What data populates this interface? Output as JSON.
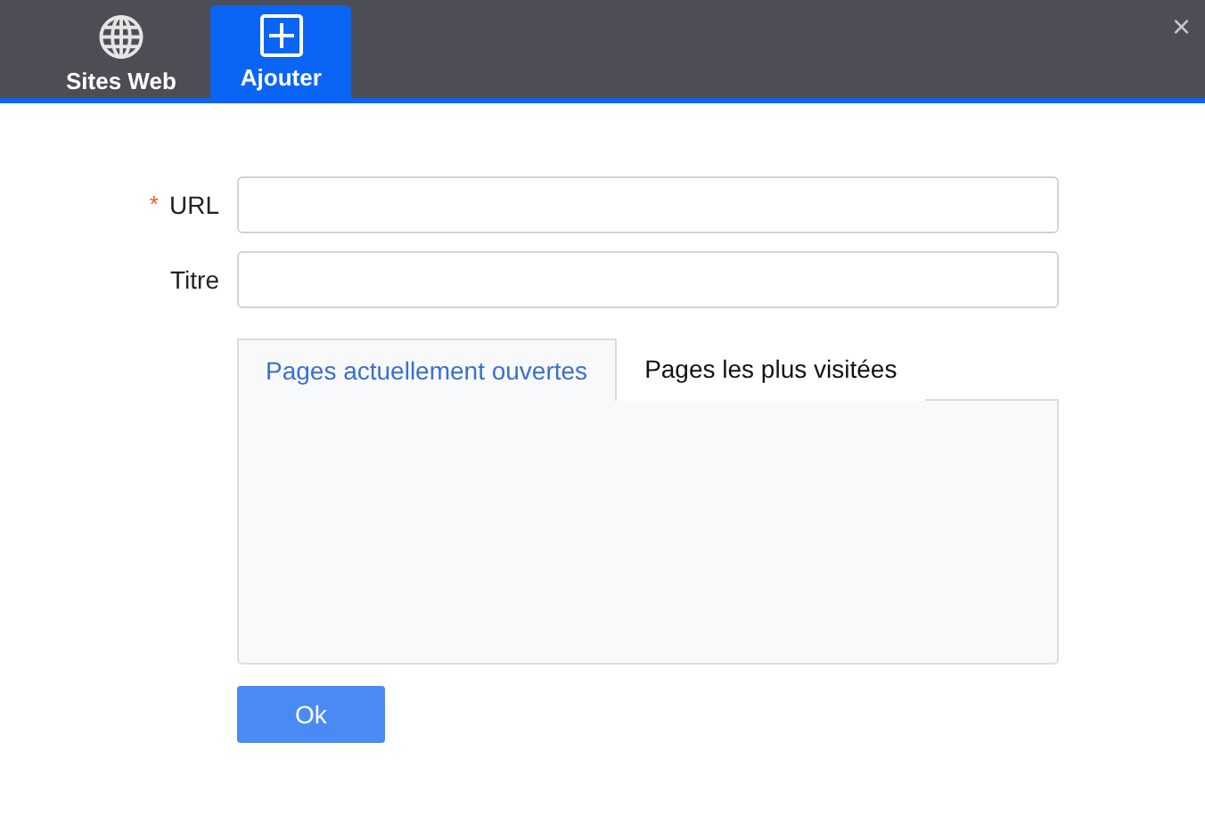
{
  "toolbar": {
    "tabs": [
      {
        "label": "Sites Web",
        "kind": "globe",
        "selected": false
      },
      {
        "label": "Ajouter",
        "kind": "add",
        "selected": true
      }
    ],
    "close": "×"
  },
  "form": {
    "fields": [
      {
        "label": "URL",
        "required_mark": "*"
      },
      {
        "label": "Titre"
      }
    ]
  },
  "page_tabs": [
    {
      "label": "Pages actuellement ouvertes",
      "selected": true
    },
    {
      "label": "Pages les plus visitées",
      "selected": false
    }
  ],
  "button": "Ok"
}
